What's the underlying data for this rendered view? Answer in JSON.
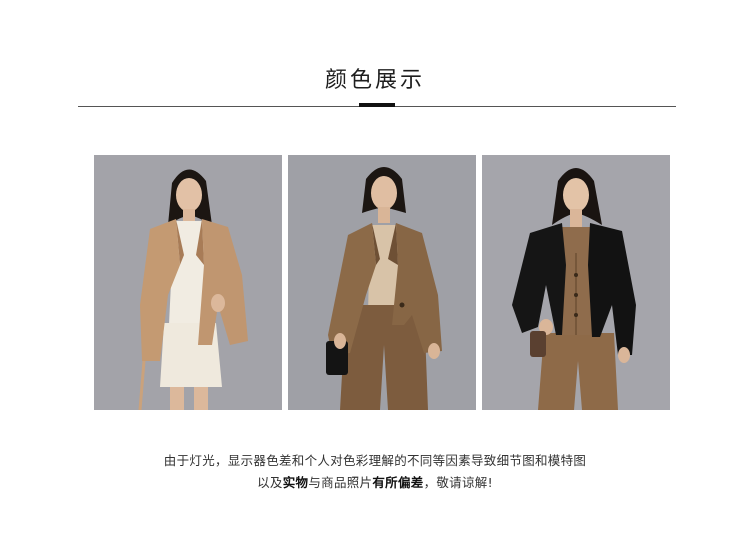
{
  "header": {
    "title": "颜色展示"
  },
  "photos": [
    {
      "label": "camel blazer with cream knit and skirt"
    },
    {
      "label": "brown blazer with beige top and trousers"
    },
    {
      "label": "black blazer with brown vest and trousers"
    }
  ],
  "disclaimer": {
    "line1": "由于灯光，显示器色差和个人对色彩理解的不同等因素导致细节图和模特图",
    "line2_prefix": "以及",
    "line2_bold1": "实物",
    "line2_mid": "与商品照片",
    "line2_bold2": "有所偏差",
    "line2_suffix": "，敬请谅解!"
  },
  "colors": {
    "background": "#ffffff",
    "photo_backdrop": "#a2a2a8",
    "camel": "#c49a72",
    "brown": "#8c6a48",
    "black": "#151515"
  }
}
